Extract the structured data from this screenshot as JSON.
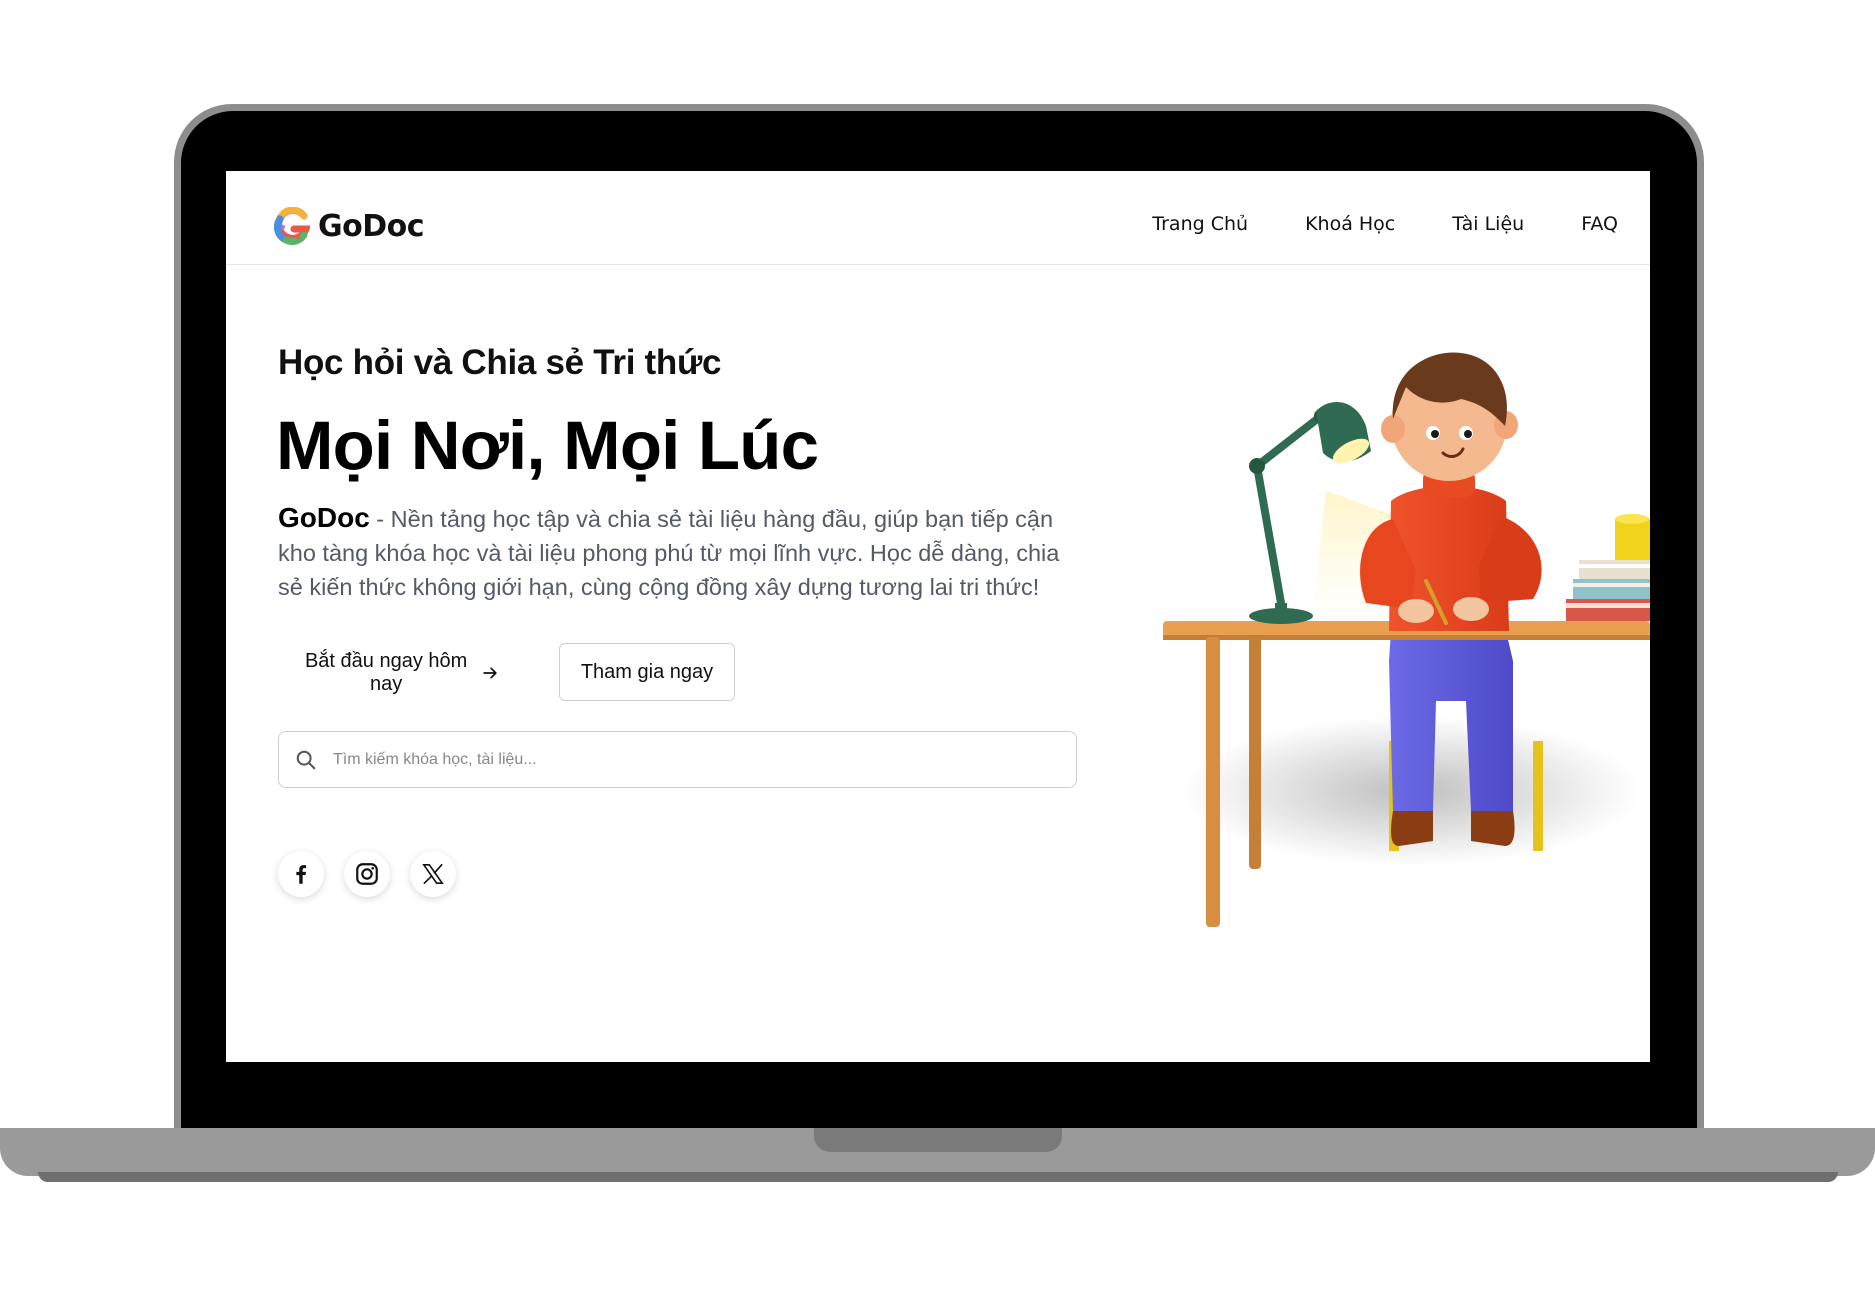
{
  "brand": {
    "name": "GoDoc"
  },
  "nav": {
    "items": [
      {
        "label": "Trang Chủ"
      },
      {
        "label": "Khoá Học"
      },
      {
        "label": "Tài Liệu"
      },
      {
        "label": "FAQ"
      }
    ]
  },
  "hero": {
    "subtitle": "Học hỏi và Chia sẻ Tri thức",
    "headline": "Mọi Nơi, Mọi Lúc",
    "description_brand": "GoDoc",
    "description": " - Nền tảng học tập và chia sẻ tài liệu hàng đầu, giúp bạn tiếp cận kho tàng khóa học và tài liệu phong phú từ mọi lĩnh vực. Học dễ dàng, chia sẻ kiến thức không giới hạn, cùng cộng đồng xây dựng tương lai tri thức!",
    "primary_button": "Bắt đầu ngay hôm nay",
    "secondary_button": "Tham gia ngay"
  },
  "search": {
    "placeholder": "Tìm kiếm khóa học, tài liệu...",
    "value": ""
  },
  "socials": [
    {
      "icon": "facebook-icon"
    },
    {
      "icon": "instagram-icon"
    },
    {
      "icon": "x-twitter-icon"
    }
  ],
  "colors": {
    "text": "#111111",
    "muted": "#555a68",
    "border": "#cfcfcf",
    "sweater": "#e8401e",
    "pants": "#5b57d9",
    "lamp": "#2f6b52",
    "desk": "#e8a050"
  }
}
